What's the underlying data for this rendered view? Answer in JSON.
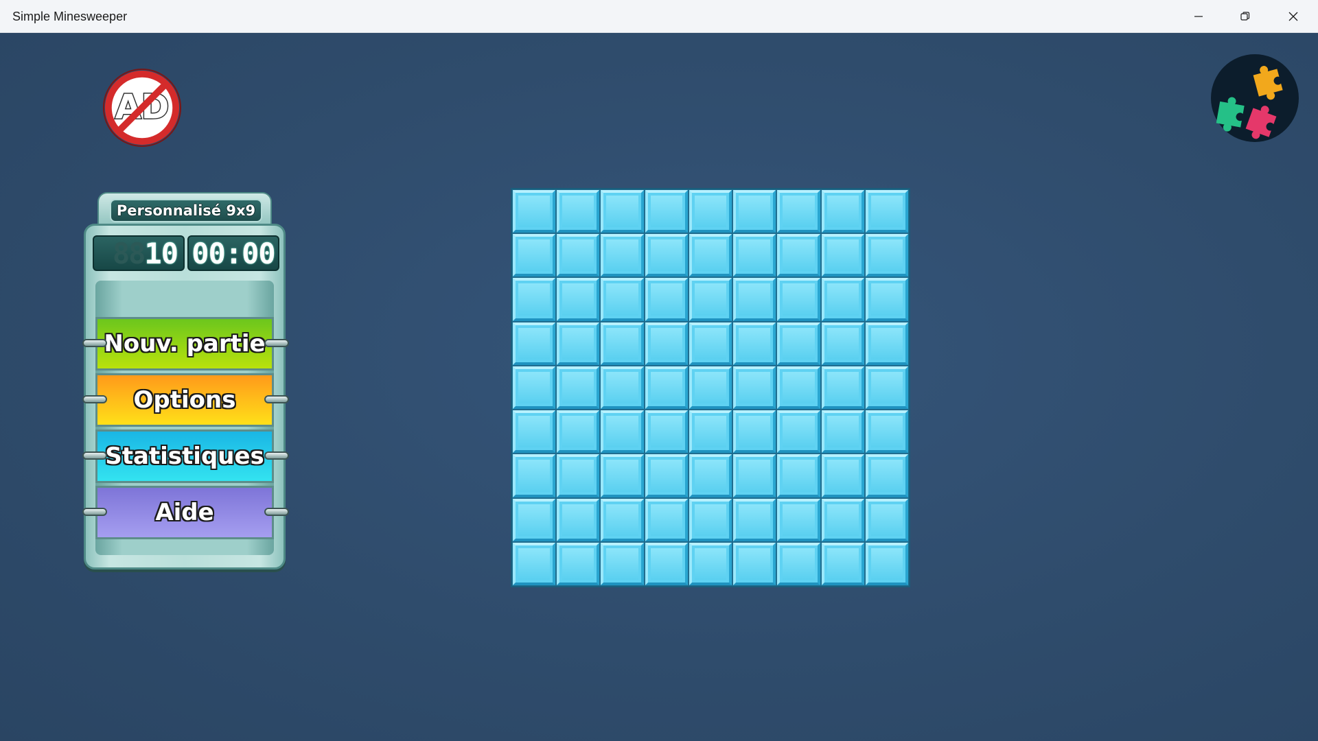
{
  "window": {
    "title": "Simple Minesweeper",
    "controls": [
      "minimize-icon",
      "restore-icon",
      "close-icon"
    ]
  },
  "icons": {
    "no_ads_text": "AD",
    "puzzle": "puzzle-pieces-icon"
  },
  "panel": {
    "mode_label": "Personnalisé 9x9",
    "mine_counter": "10",
    "mine_counter_ghost": "88",
    "timer": "00:00",
    "buttons": {
      "new_game": "Nouv. partie",
      "options": "Options",
      "stats": "Statistiques",
      "help": "Aide"
    }
  },
  "board": {
    "rows": 9,
    "cols": 9,
    "state": "all-covered"
  },
  "colors": {
    "background": "#2e4a68",
    "cell": "#5fd2f2",
    "btn_new": "#8fd416",
    "btn_options": "#ffb91a",
    "btn_stats": "#22c8ea",
    "btn_help": "#8f87e4"
  }
}
